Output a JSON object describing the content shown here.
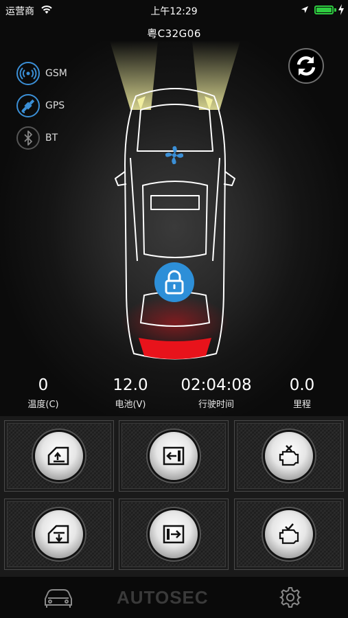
{
  "status_bar": {
    "carrier": "运营商",
    "time": "上午12:29",
    "battery_level": 1.0,
    "battery_color": "#2ecc40"
  },
  "vehicle": {
    "plate": "粤C32G06"
  },
  "connectivity": [
    {
      "label": "GSM",
      "icon": "signal-icon",
      "active": true
    },
    {
      "label": "GPS",
      "icon": "satellite-icon",
      "active": true
    },
    {
      "label": "BT",
      "icon": "bluetooth-icon",
      "active": false
    }
  ],
  "controls": {
    "refresh_icon": "refresh-icon",
    "fan_icon": "fan-icon",
    "lock_icon": "lock-icon",
    "lock_state": "locked"
  },
  "stats": [
    {
      "value": "0",
      "label": "温度(C)"
    },
    {
      "value": "12.0",
      "label": "电池(V)"
    },
    {
      "value": "02:04:08",
      "label": "行驶时间"
    },
    {
      "value": "0.0",
      "label": "里程"
    }
  ],
  "action_buttons": [
    {
      "icon": "window-up-icon"
    },
    {
      "icon": "door-lock-icon"
    },
    {
      "icon": "engine-off-icon"
    },
    {
      "icon": "window-down-icon"
    },
    {
      "icon": "door-unlock-icon"
    },
    {
      "icon": "engine-start-icon"
    }
  ],
  "tab_bar": {
    "brand": "AUTOSEC",
    "left_icon": "car-icon",
    "right_icon": "gear-icon"
  },
  "colors": {
    "accent": "#2d8fd8",
    "tail_light": "#e8131b",
    "head_light": "#f2efa0"
  }
}
